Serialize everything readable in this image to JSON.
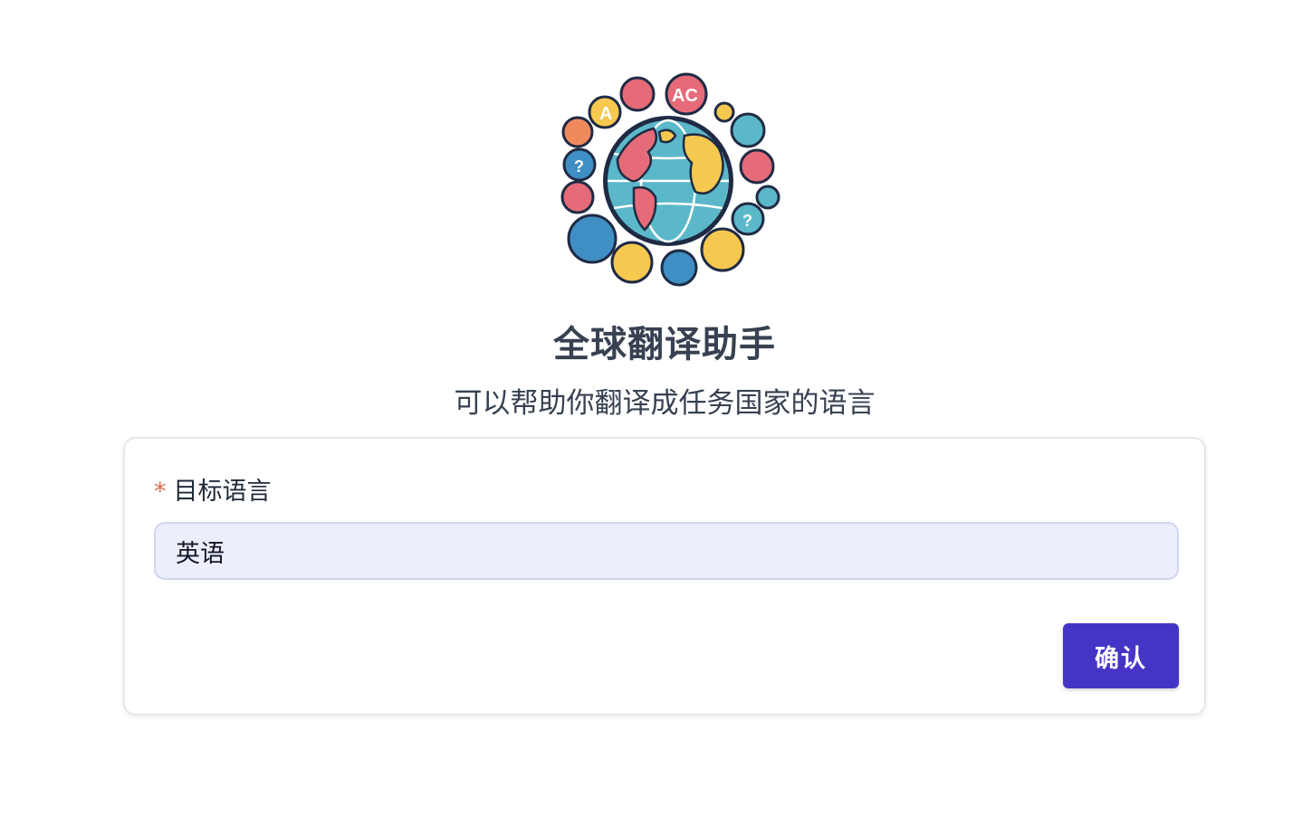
{
  "header": {
    "logo_icon": "globe-speech-bubbles-logo",
    "title": "全球翻译助手",
    "subtitle": "可以帮助你翻译成任务国家的语言"
  },
  "form": {
    "field_label": "目标语言",
    "required_marker": "*",
    "input_value": "英语",
    "confirm_label": "确认"
  },
  "colors": {
    "accent": "#4535c6",
    "input_bg": "#eceefc",
    "required": "#dc6b4d",
    "text": "#374151"
  }
}
